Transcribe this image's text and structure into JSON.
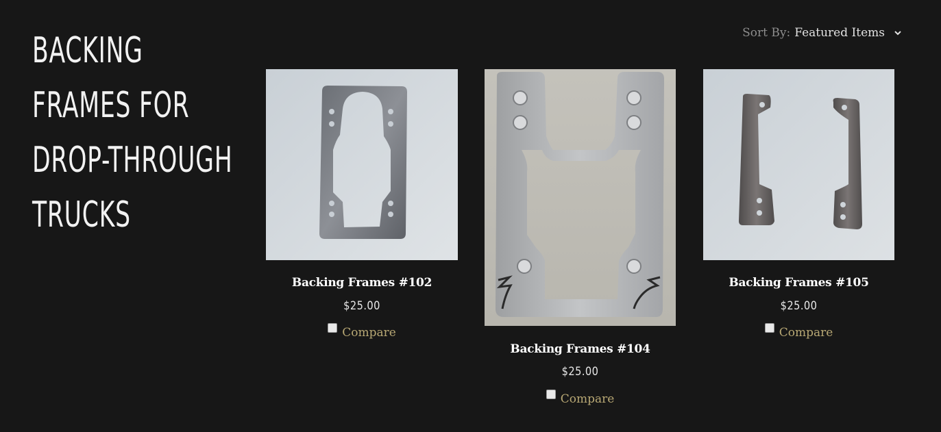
{
  "page": {
    "title": "BACKING FRAMES FOR DROP-THROUGH TRUCKS"
  },
  "sort": {
    "label": "Sort By:",
    "value": "Featured Items",
    "icon": "chevron-down-icon"
  },
  "products": [
    {
      "name": "Backing Frames #102",
      "price": "$25.00",
      "compare_label": "Compare"
    },
    {
      "name": "Backing Frames #104",
      "price": "$25.00",
      "compare_label": "Compare"
    },
    {
      "name": "Backing Frames #105",
      "price": "$25.00",
      "compare_label": "Compare"
    }
  ],
  "colors": {
    "background": "#171717",
    "title": "#f2f2f2",
    "compare_link": "#b8a874",
    "sort_label": "#8e8e8e"
  }
}
